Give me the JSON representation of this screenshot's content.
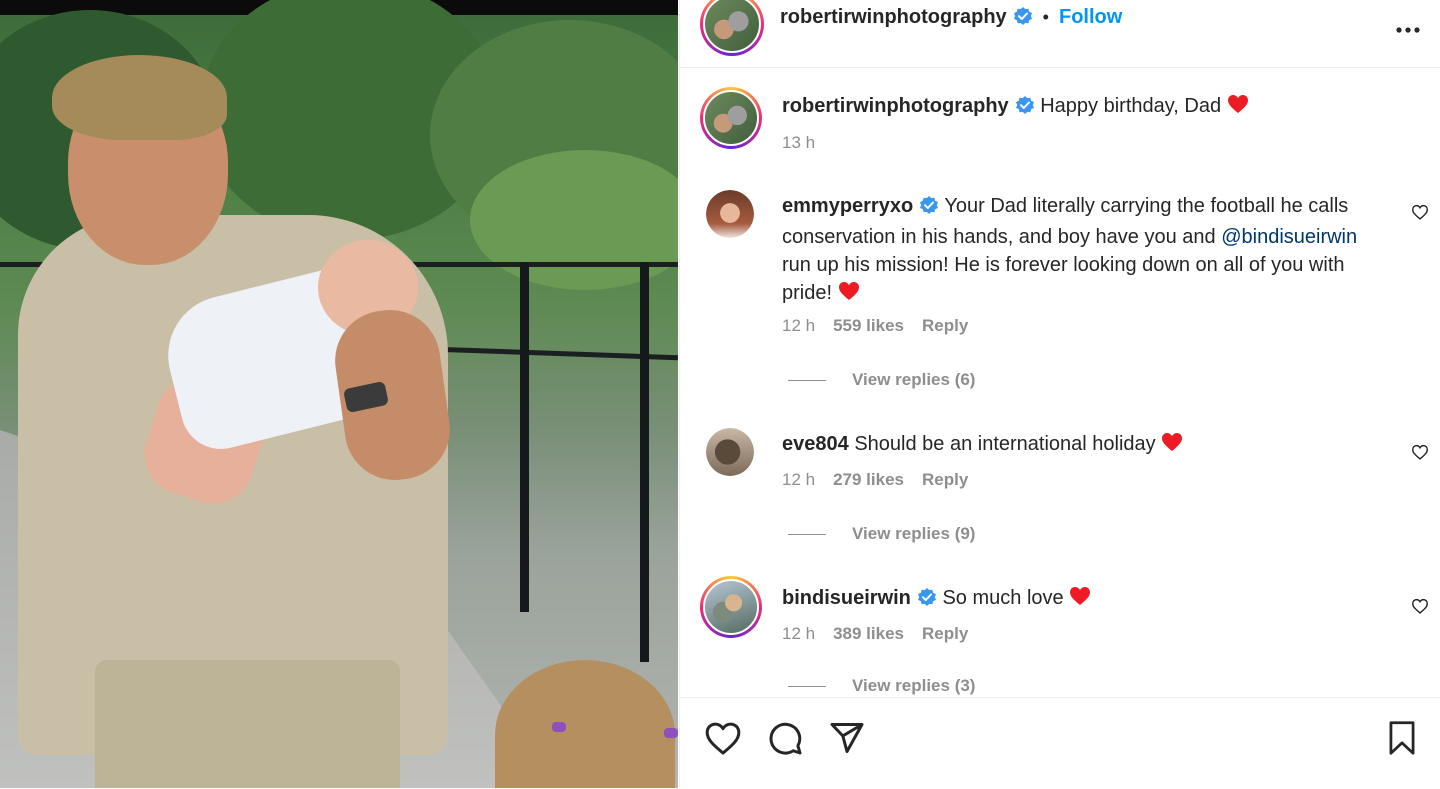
{
  "post": {
    "author": "robertirwinphotography",
    "follow_label": "Follow",
    "caption": "Happy birthday, Dad",
    "caption_time": "13 h"
  },
  "comments": [
    {
      "user": "emmyperryxo",
      "verified": true,
      "text_before": "Your Dad literally carrying the football he calls conservation in his hands, and boy have you and ",
      "mention": "@bindisueirwin",
      "text_after": " run up his mission! He is forever looking down on all of you with pride!",
      "time": "12 h",
      "likes": "559 likes",
      "reply": "Reply",
      "view_replies": "View replies (6)"
    },
    {
      "user": "eve804",
      "verified": false,
      "text": "Should be an international holiday",
      "time": "12 h",
      "likes": "279 likes",
      "reply": "Reply",
      "view_replies": "View replies (9)"
    },
    {
      "user": "bindisueirwin",
      "verified": true,
      "text": "So much love",
      "time": "12 h",
      "likes": "389 likes",
      "reply": "Reply",
      "view_replies": "View replies (3)"
    }
  ],
  "icons": {
    "like": "heart-icon",
    "comment": "comment-icon",
    "share": "share-icon",
    "save": "bookmark-icon",
    "more": "more-options-icon",
    "verified": "verified-badge-icon",
    "emoji": "red-heart-emoji"
  },
  "colors": {
    "link": "#0095f6",
    "mention": "#00376b",
    "verified": "#3897f0",
    "heart": "#ed1c24",
    "muted": "#8e8e8e"
  }
}
